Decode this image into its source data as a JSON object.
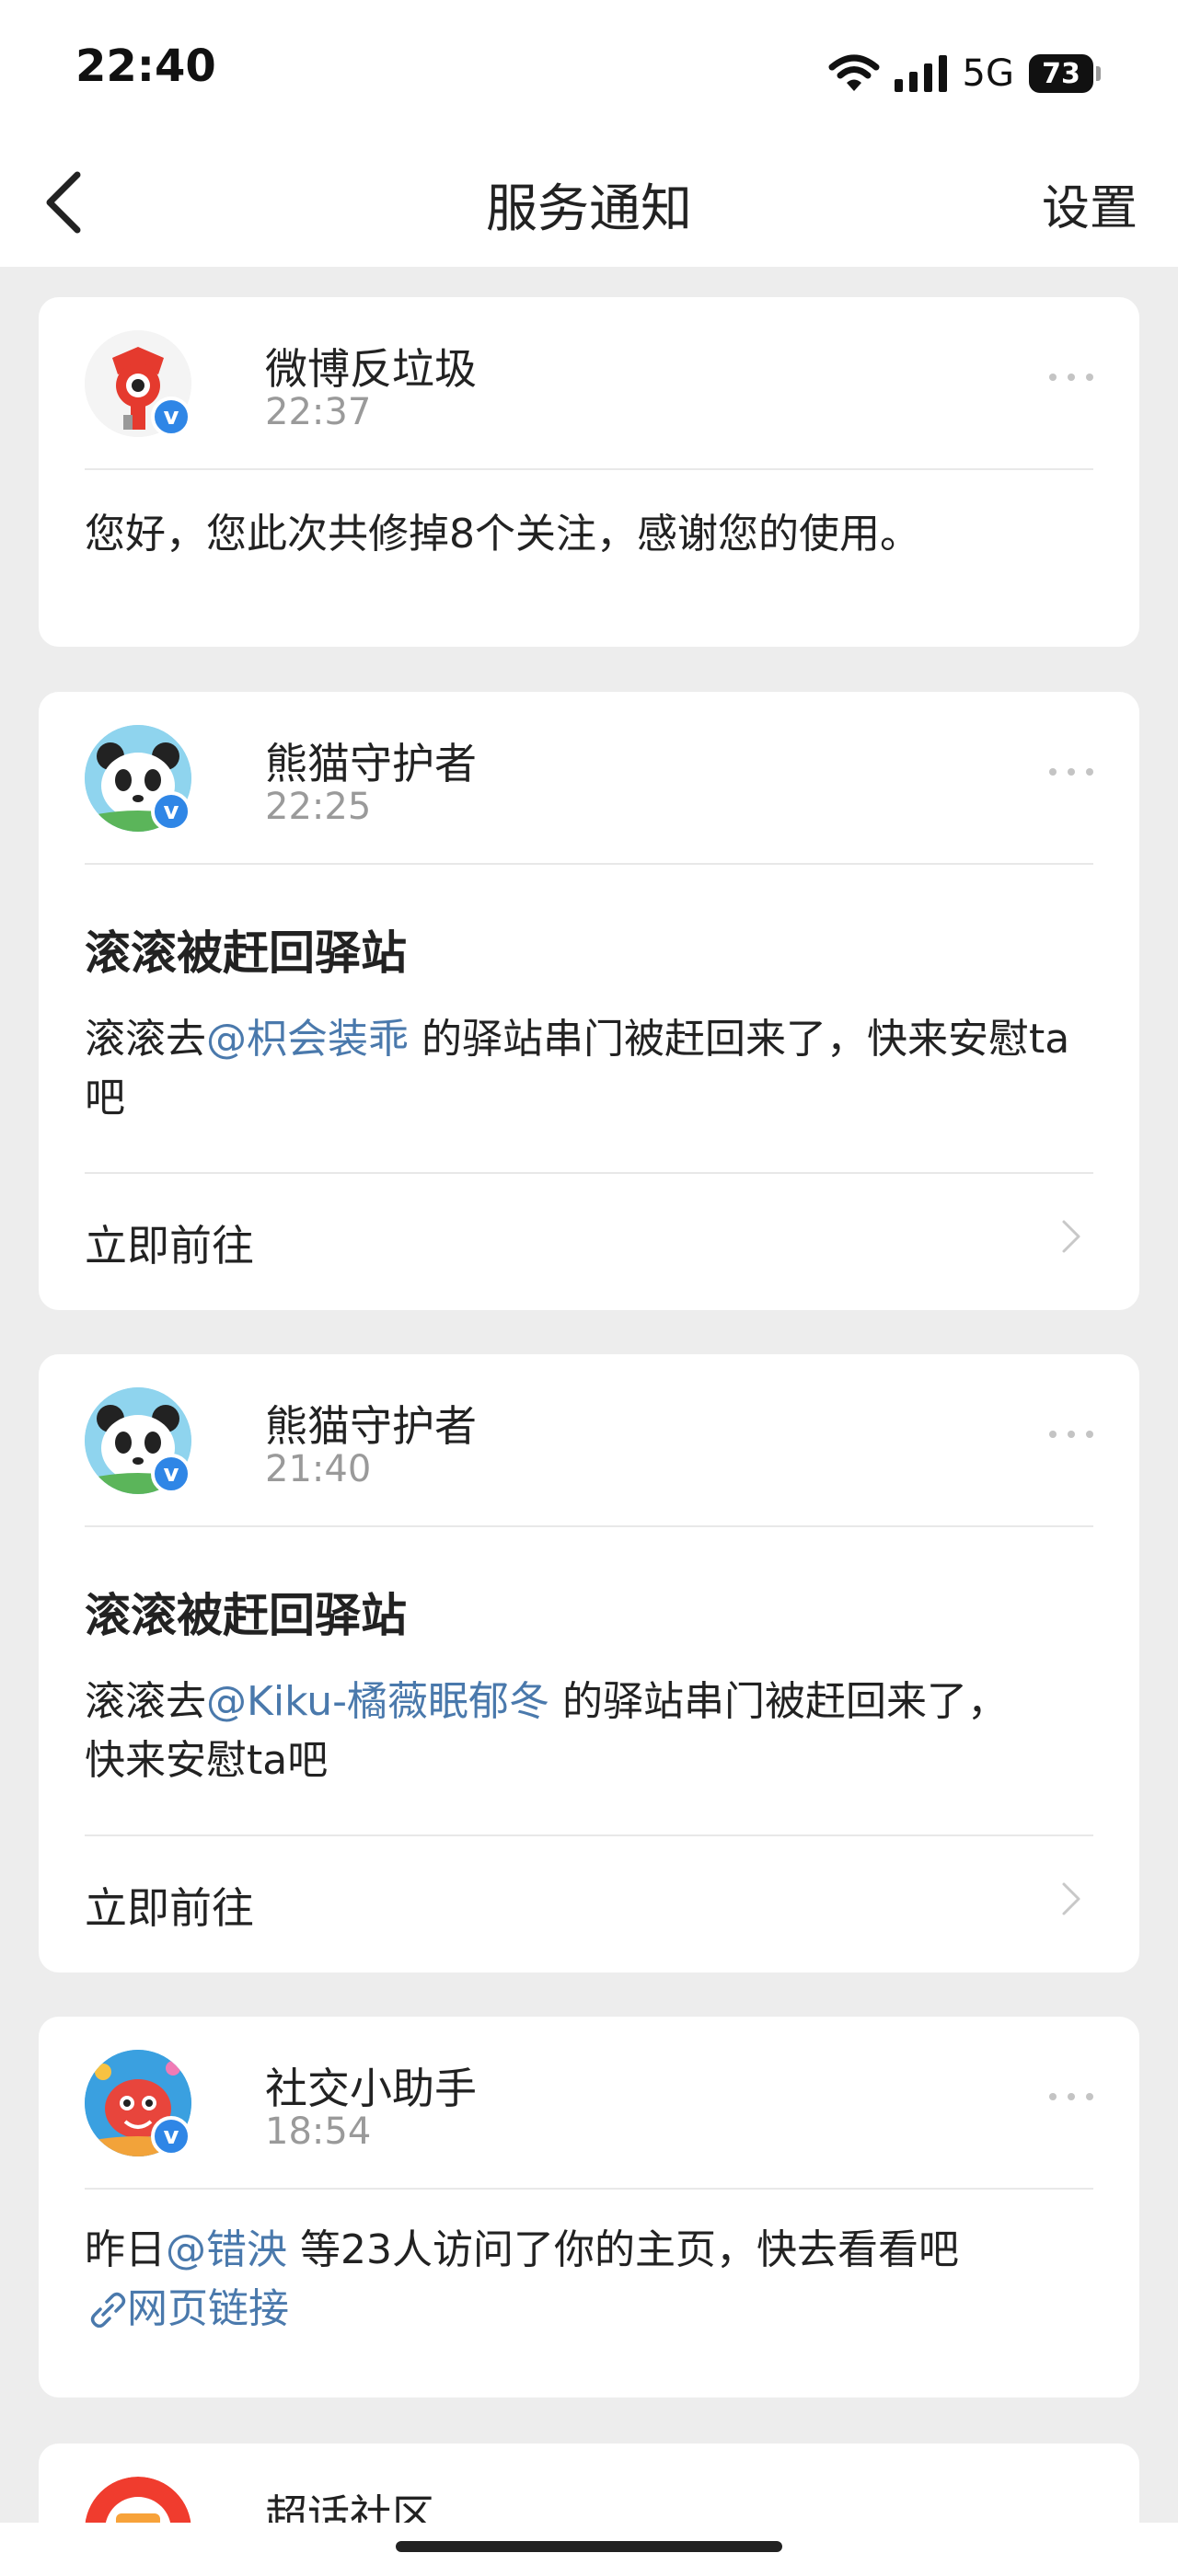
{
  "status": {
    "time": "22:40",
    "network": "5G",
    "battery": "73"
  },
  "nav": {
    "title": "服务通知",
    "settings": "设置"
  },
  "cards": [
    {
      "sender": "微博反垃圾",
      "time": "22:37",
      "message": "您好，您此次共修掉8个关注，感谢您的使用。"
    },
    {
      "sender": "熊猫守护者",
      "time": "22:25",
      "heading": "滚滚被赶回驿站",
      "msg_pre": "滚滚去",
      "mention": "@枳会装乖",
      "msg_post": " 的驿站串门被赶回来了，快来安慰ta吧",
      "action": "立即前往"
    },
    {
      "sender": "熊猫守护者",
      "time": "21:40",
      "heading": "滚滚被赶回驿站",
      "msg_pre": "滚滚去",
      "mention": "@Kiku-橘薇眠郁冬",
      "msg_post": " 的驿站串门被赶回来了，快来安慰ta吧",
      "action": "立即前往"
    },
    {
      "sender": "社交小助手",
      "time": "18:54",
      "msg_pre": "昨日",
      "mention": "@错泱",
      "msg_post": " 等23人访问了你的主页，快去看看吧",
      "link": "网页链接"
    },
    {
      "sender": "超话社区"
    }
  ]
}
